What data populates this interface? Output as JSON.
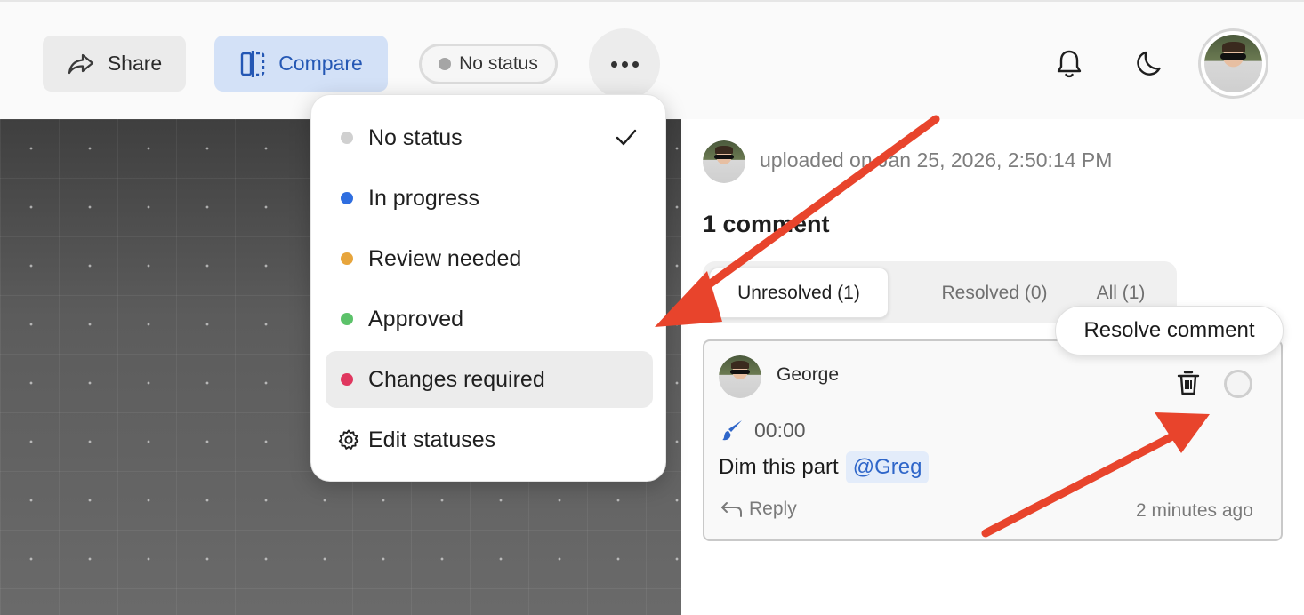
{
  "toolbar": {
    "share_label": "Share",
    "compare_label": "Compare",
    "status_label": "No status"
  },
  "status_menu": {
    "items": [
      {
        "label": "No status",
        "color": "#d0d0d0",
        "checked": true
      },
      {
        "label": "In progress",
        "color": "#2f6ee0"
      },
      {
        "label": "Review needed",
        "color": "#e7a53c"
      },
      {
        "label": "Approved",
        "color": "#5cc26a"
      },
      {
        "label": "Changes required",
        "color": "#e0375f",
        "highlighted": true
      }
    ],
    "edit_label": "Edit statuses"
  },
  "upload": {
    "text": "uploaded on Jan 25, 2026, 2:50:14 PM"
  },
  "comments": {
    "title": "1 comment",
    "tabs": [
      {
        "label": "Unresolved (1)",
        "active": true
      },
      {
        "label": "Resolved (0)"
      },
      {
        "label": "All (1)"
      }
    ],
    "list": [
      {
        "author": "George",
        "timecode": "00:00",
        "text": "Dim this part",
        "mention": "@Greg",
        "reply_label": "Reply",
        "time_ago": "2 minutes ago"
      }
    ],
    "resolve_tooltip": "Resolve comment"
  },
  "colors": {
    "accent": "#2457b4",
    "annotation_arrow": "#e8442c"
  }
}
